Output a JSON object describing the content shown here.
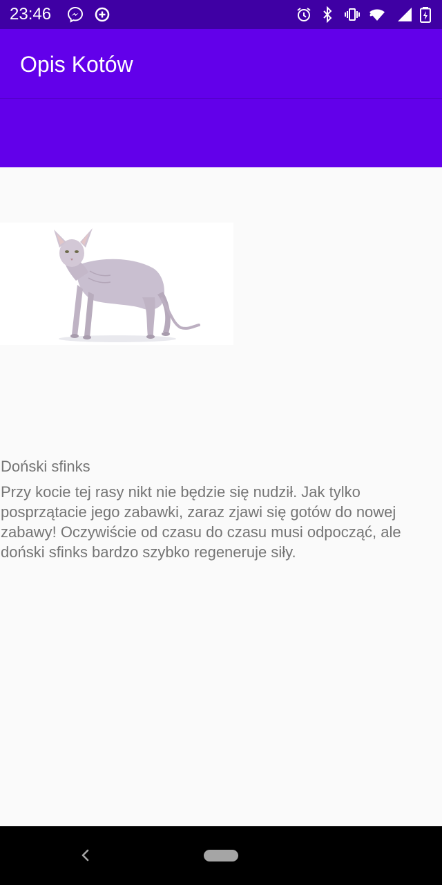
{
  "status_bar": {
    "time": "23:46",
    "left_icons": [
      "messenger-icon",
      "data-saver-icon"
    ],
    "right_icons": [
      "alarm-icon",
      "bluetooth-icon",
      "vibrate-icon",
      "wifi-icon",
      "cell-signal-icon",
      "battery-charging-icon"
    ]
  },
  "app_bar": {
    "title": "Opis Kotów",
    "color": "#6200ea",
    "status_color": "#3f00a4"
  },
  "content": {
    "image_subject": "cat-image",
    "breed_name": "Doński sfinks",
    "description": "Przy kocie tej rasy nikt nie będzie się nudził. Jak tylko posprzątacie jego zabawki, zaraz zjawi się gotów do nowej zabawy! Oczywiście od czasu do czasu musi odpocząć, ale doński sfinks bardzo szybko regeneruje siły."
  },
  "nav_bar": {
    "icons": [
      "back-icon",
      "home-pill-icon"
    ]
  }
}
